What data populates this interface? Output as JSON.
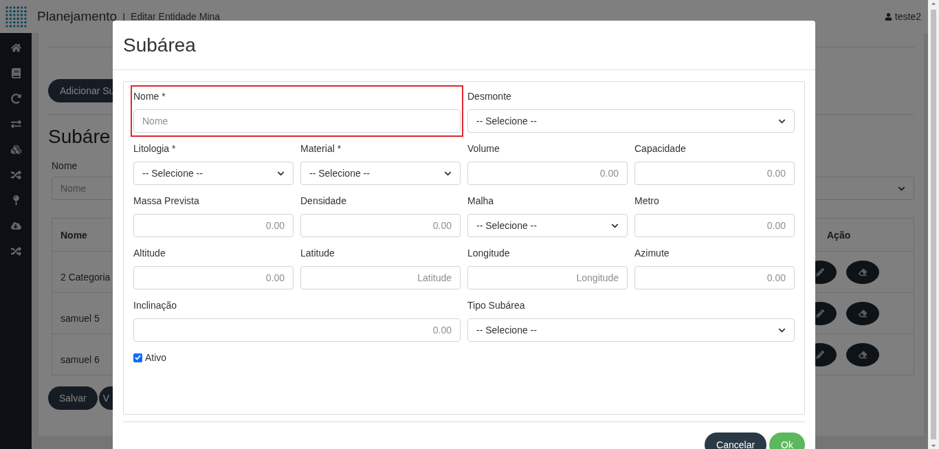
{
  "header": {
    "app_title": "Planejamento",
    "separator": "|",
    "page_title": "Editar Entidade Mina",
    "user": "teste2"
  },
  "background": {
    "add_button": "Adicionar Su",
    "heading": "Subáre",
    "filter": {
      "label": "Nome",
      "placeholder": "Nome"
    },
    "table": {
      "columns": [
        "Nome",
        "Ação"
      ],
      "rows": [
        {
          "name": "2 Categoria"
        },
        {
          "name": "samuel 5"
        },
        {
          "name": "samuel 6"
        }
      ]
    },
    "buttons": [
      "Salvar",
      "V"
    ]
  },
  "modal": {
    "title": "Subárea",
    "rows": [
      [
        {
          "label": "Nome *",
          "kind": "text",
          "placeholder": "Nome",
          "highlighted": true
        },
        {
          "label": "Desmonte",
          "kind": "select",
          "value": "-- Selecione --",
          "highlighted": false
        }
      ],
      [
        {
          "label": "Litologia *",
          "kind": "select",
          "value": "-- Selecione --",
          "highlighted": false
        },
        {
          "label": "Material *",
          "kind": "select",
          "value": "-- Selecione --",
          "highlighted": false
        },
        {
          "label": "Volume",
          "kind": "number",
          "placeholder": "0.00",
          "highlighted": false
        },
        {
          "label": "Capacidade",
          "kind": "number",
          "placeholder": "0.00",
          "highlighted": false
        }
      ],
      [
        {
          "label": "Massa Prevista",
          "kind": "number",
          "placeholder": "0.00",
          "highlighted": false
        },
        {
          "label": "Densidade",
          "kind": "number",
          "placeholder": "0.00",
          "highlighted": false
        },
        {
          "label": "Malha",
          "kind": "select",
          "value": "-- Selecione --",
          "highlighted": false
        },
        {
          "label": "Metro",
          "kind": "number",
          "placeholder": "0.00",
          "highlighted": false
        }
      ],
      [
        {
          "label": "Altitude",
          "kind": "number",
          "placeholder": "0.00",
          "highlighted": false
        },
        {
          "label": "Latitude",
          "kind": "number",
          "placeholder": "Latitude",
          "highlighted": false
        },
        {
          "label": "Longitude",
          "kind": "number",
          "placeholder": "Longitude",
          "highlighted": false
        },
        {
          "label": "Azimute",
          "kind": "number",
          "placeholder": "0.00",
          "highlighted": false
        }
      ],
      [
        {
          "label": "Inclinação",
          "kind": "number",
          "placeholder": "0.00",
          "highlighted": false
        },
        {
          "label": "Tipo Subárea",
          "kind": "select",
          "value": "-- Selecione --",
          "highlighted": false
        }
      ]
    ],
    "active": {
      "label": "Ativo",
      "checked": true
    },
    "buttons": [
      {
        "label": "Cancelar",
        "kind": "secondary"
      },
      {
        "label": "Ok",
        "kind": "primary"
      }
    ]
  }
}
